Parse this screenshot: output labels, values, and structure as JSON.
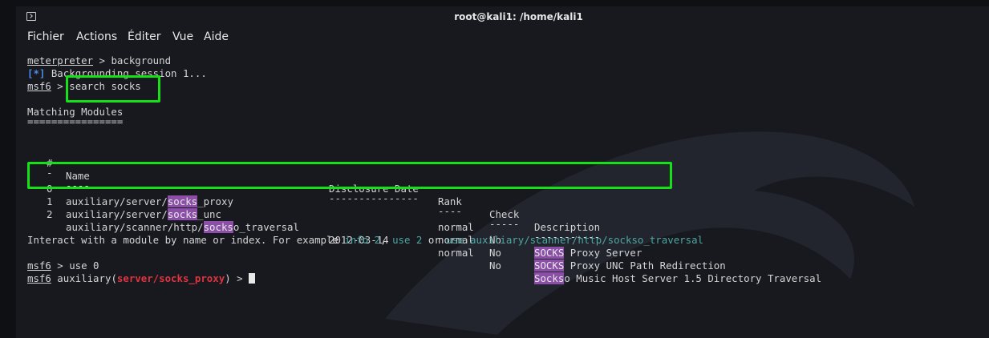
{
  "window": {
    "title": "root@kali1: /home/kali1"
  },
  "menu": {
    "items": [
      "Fichier",
      "Actions",
      "Éditer",
      "Vue",
      "Aide"
    ]
  },
  "terminal": {
    "l1_prompt": "meterpreter",
    "l1_rest": " > background",
    "l2_tag": "[*]",
    "l2_rest": " Backgrounding session 1...",
    "l3_prompt": "msf6",
    "l3_gt": " > ",
    "l3_cmd": "search socks",
    "matching": "Matching Modules",
    "matching_rule": "================",
    "headers": {
      "num": "#",
      "name": "Name",
      "date": "Disclosure Date",
      "rank": "Rank",
      "check": "Check",
      "desc": "Description"
    },
    "header_rules": {
      "num": "-",
      "name": "----",
      "date": "---------------",
      "rank": "----",
      "check": "-----",
      "desc": "-----------"
    },
    "rows": [
      {
        "num": "0",
        "name_pre": "auxiliary/server/",
        "name_hl": "socks",
        "name_post": "_proxy",
        "date": "",
        "rank": "normal",
        "check": "No",
        "desc_hl": "SOCKS",
        "desc_post": " Proxy Server"
      },
      {
        "num": "1",
        "name_pre": "auxiliary/server/",
        "name_hl": "socks",
        "name_post": "_unc",
        "date": "",
        "rank": "normal",
        "check": "No",
        "desc_hl": "SOCKS",
        "desc_post": " Proxy UNC Path Redirection"
      },
      {
        "num": "2",
        "name_pre": "auxiliary/scanner/http/",
        "name_hl": "socks",
        "name_post": "o_traversal",
        "date": "2012-03-14",
        "rank": "normal",
        "check": "No",
        "desc_hl": "Socks",
        "desc_post": "o Music Host Server 1.5 Directory Traversal"
      }
    ],
    "interact_1": "Interact with a module by name or index. For example ",
    "interact_info": "info 2",
    "interact_2": ", ",
    "interact_use2": "use 2",
    "interact_3": " or ",
    "interact_use_full": "use auxiliary/scanner/http/sockso_traversal",
    "l_use_prompt": "msf6",
    "l_use_rest": " > use 0",
    "l_last_prompt": "msf6",
    "l_last_mid": " auxiliary(",
    "l_last_mod": "server/socks_proxy",
    "l_last_end": ") > "
  },
  "colors": {
    "highlight_box": "#16e016",
    "match_highlight": "#8b4fa8",
    "prompt_blue": "#4b8ae6",
    "module_red": "#e0333f",
    "hint_teal": "#4fa6a2"
  }
}
